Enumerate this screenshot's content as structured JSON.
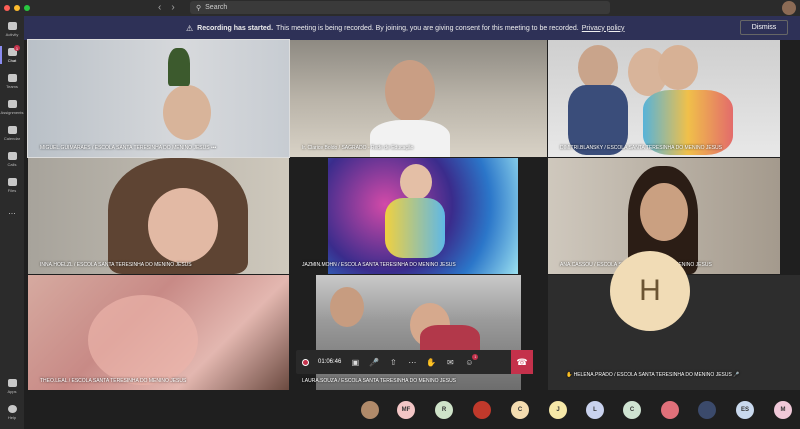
{
  "topbar": {
    "search_placeholder": "Search",
    "nav": [
      "‹",
      "›"
    ]
  },
  "sidebar": {
    "items": [
      {
        "label": "Activity",
        "badge": ""
      },
      {
        "label": "Chat",
        "badge": "1"
      },
      {
        "label": "Teams",
        "badge": ""
      },
      {
        "label": "Assignments",
        "badge": ""
      },
      {
        "label": "Calendar",
        "badge": ""
      },
      {
        "label": "Calls",
        "badge": ""
      },
      {
        "label": "Files",
        "badge": ""
      },
      {
        "label": "...",
        "badge": ""
      }
    ],
    "bottom": [
      {
        "label": "Apps"
      },
      {
        "label": "Help"
      }
    ]
  },
  "banner": {
    "title": "Recording has started.",
    "message": "This meeting is being recorded. By joining, you are giving consent for this meeting to be recorded.",
    "link": "Privacy policy",
    "dismiss": "Dismiss"
  },
  "participants": [
    {
      "name": "MIGUEL.GUIMARAES / ESCOLA SANTA TERESINHA DO MENINO JESUS  •••"
    },
    {
      "name": "Ir. Clarice Boldo / SAGRADO - Rede de Educação"
    },
    {
      "name": "DIMITRI.BLANSKY / ESCOLA SANTA TERESINHA DO MENINO JESUS"
    },
    {
      "name": "INNA.HOELZL / ESCOLA SANTA TERESINHA DO MENINO JESUS"
    },
    {
      "name": "JAZMIN.MOHN / ESCOLA SANTA TERESINHA DO MENINO JESUS"
    },
    {
      "name": "ANA.CASSOU / ESCOLA SANTA TERESINHA DO MENINO JESUS"
    },
    {
      "name": "THEO.LEAL / ESCOLA SANTA TERESINHA DO MENINO JESUS"
    },
    {
      "name": "LAURA.SOUZA / ESCOLA SANTA TERESINHA DO MENINO JESUS"
    },
    {
      "name": "✋ HELENA.PRADO / ESCOLA SANTA TERESINHA DO MENINO JESUS 🎤",
      "initial": "H"
    }
  ],
  "controls": {
    "timer": "01:06:46",
    "icons": [
      "video-icon",
      "mic-icon",
      "share-icon",
      "more-icon",
      "raise-hand-icon",
      "chat-icon",
      "people-icon"
    ],
    "people_badge": "1"
  },
  "bottom_avatars": [
    {
      "initials": "",
      "color": "#b08a6a"
    },
    {
      "initials": "MF",
      "color": "#f3c6c6"
    },
    {
      "initials": "R",
      "color": "#cfe3c9"
    },
    {
      "initials": "",
      "color": "#c0392b"
    },
    {
      "initials": "C",
      "color": "#f4dcb0"
    },
    {
      "initials": "J",
      "color": "#f6e8a8"
    },
    {
      "initials": "L",
      "color": "#c9d2ee"
    },
    {
      "initials": "C",
      "color": "#cfe3d2"
    },
    {
      "initials": "",
      "color": "#e0707a"
    },
    {
      "initials": "",
      "color": "#3b4a6b"
    },
    {
      "initials": "ES",
      "color": "#c9d9ee"
    },
    {
      "initials": "M",
      "color": "#f0c8d8"
    }
  ]
}
